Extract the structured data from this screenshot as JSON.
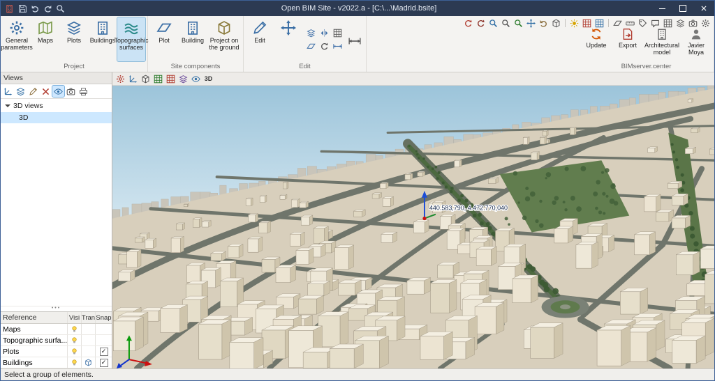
{
  "colors": {
    "titlebar": "#2c3a52",
    "ribbon_selection": "#cbe3f5",
    "tree_selection": "#cde8ff",
    "sky": "#a9cede",
    "accent": "#3a6ea5",
    "city_ground": "#d8cfbc"
  },
  "titlebar": {
    "title": "Open BIM Site - v2022.a - [C:\\...\\Madrid.bsite]"
  },
  "quick_access": [
    {
      "name": "save",
      "sym": "floppy"
    },
    {
      "name": "undo",
      "sym": "undo"
    },
    {
      "name": "redo",
      "sym": "redo"
    },
    {
      "name": "zoom",
      "sym": "magnifier"
    }
  ],
  "ribbon": {
    "groups": [
      {
        "label": "Project",
        "buttons": [
          {
            "label": "General parameters",
            "icon": "gear"
          },
          {
            "label": "Maps",
            "icon": "map"
          },
          {
            "label": "Plots",
            "icon": "layers"
          },
          {
            "label": "Buildings",
            "icon": "building"
          },
          {
            "label": "Topographic surfaces",
            "icon": "surface",
            "selected": true
          }
        ]
      },
      {
        "label": "Site components",
        "buttons": [
          {
            "label": "Plot",
            "icon": "plane"
          },
          {
            "label": "Building",
            "icon": "building"
          },
          {
            "label": "Project on the ground",
            "icon": "cube"
          }
        ]
      },
      {
        "label": "Edit",
        "buttons": [
          {
            "label": "Edit",
            "icon": "pencil"
          }
        ]
      },
      {
        "label": "BIMserver.center",
        "buttons": [
          {
            "label": "Update",
            "icon": "update"
          },
          {
            "label": "Export",
            "icon": "doc-export"
          },
          {
            "label": "Architectural model",
            "icon": "building"
          },
          {
            "label": "Javier Moya",
            "icon": "person"
          }
        ]
      }
    ],
    "edit_tools": [
      {
        "name": "copy",
        "sym": "layers",
        "color": "#3f6fa8"
      },
      {
        "name": "mirror",
        "sym": "mirror",
        "color": "#3f6fa8"
      },
      {
        "name": "align",
        "sym": "grid",
        "color": "#555555"
      },
      {
        "name": "offset",
        "sym": "plane",
        "color": "#3f6fa8"
      },
      {
        "name": "rotate",
        "sym": "orbit",
        "color": "#555555"
      },
      {
        "name": "scale",
        "sym": "measure-h",
        "color": "#3f6fa8"
      }
    ]
  },
  "nav_toolbar": {
    "icons": [
      {
        "name": "orbit",
        "sym": "orbit",
        "color": "#b03a2e"
      },
      {
        "name": "orbit-center",
        "sym": "orbit",
        "color": "#8a2d23"
      },
      {
        "name": "zoom-window",
        "sym": "magnifier",
        "color": "#2e6da4"
      },
      {
        "name": "zoom-in-out",
        "sym": "magnifier",
        "color": "#555555"
      },
      {
        "name": "zoom-extents",
        "sym": "magnifier",
        "color": "#2a7a2a"
      },
      {
        "name": "pan",
        "sym": "move",
        "color": "#2e6da4"
      },
      {
        "name": "previous-view",
        "sym": "undo",
        "color": "#8a6d3b"
      },
      {
        "name": "perspective",
        "sym": "cube",
        "color": "#555555"
      },
      {
        "sep": true
      },
      {
        "name": "shadows",
        "sym": "sun",
        "color": "#d6a400"
      },
      {
        "name": "textures",
        "sym": "grid",
        "color": "#b03a2e"
      },
      {
        "name": "edges",
        "sym": "grid",
        "color": "#2e6da4"
      },
      {
        "sep": true
      },
      {
        "name": "section-plane",
        "sym": "plane",
        "color": "#555555"
      },
      {
        "name": "measure",
        "sym": "ruler",
        "color": "#555555"
      },
      {
        "name": "dimensions",
        "sym": "tag",
        "color": "#555555"
      },
      {
        "name": "comments",
        "sym": "comment",
        "color": "#555555"
      },
      {
        "name": "reference-grid",
        "sym": "grid",
        "color": "#555555"
      },
      {
        "name": "layers",
        "sym": "layers",
        "color": "#555555"
      },
      {
        "name": "camera-views",
        "sym": "camera",
        "color": "#555555"
      },
      {
        "name": "configuration",
        "sym": "gear",
        "color": "#555555"
      }
    ]
  },
  "viewport_toolbar": {
    "icons": [
      {
        "name": "render-options",
        "sym": "gear",
        "color": "#b03a2e"
      },
      {
        "name": "work-plane",
        "sym": "axes",
        "color": "#2e6da4"
      },
      {
        "name": "view-orientation",
        "sym": "cube",
        "color": "#555555"
      },
      {
        "name": "analytical-grid",
        "sym": "grid",
        "color": "#2a7a2a"
      },
      {
        "name": "reference-grid",
        "sym": "grid",
        "color": "#b03a2e"
      },
      {
        "name": "materials",
        "sym": "layers",
        "color": "#6a4a9a"
      },
      {
        "name": "element-visibility",
        "sym": "eye",
        "color": "#2e6da4"
      },
      {
        "name": "view-3d",
        "text": "3D",
        "color": "#333333"
      }
    ]
  },
  "views_panel": {
    "title": "Views",
    "toolbar": [
      {
        "name": "new-view",
        "sym": "axes",
        "color": "#2e6da4"
      },
      {
        "name": "duplicate-view",
        "sym": "layers",
        "color": "#2e6da4"
      },
      {
        "name": "edit-view",
        "sym": "pencil",
        "color": "#8a6d3b"
      },
      {
        "name": "delete-view",
        "sym": "close",
        "color": "#b03a2e"
      },
      {
        "name": "view-settings",
        "sym": "eye",
        "color": "#2e6da4",
        "active": true
      },
      {
        "name": "camera",
        "sym": "camera",
        "color": "#555555"
      },
      {
        "name": "snapshot",
        "sym": "printer",
        "color": "#555555"
      }
    ],
    "tree": {
      "root": "3D views",
      "child": "3D"
    }
  },
  "layers_table": {
    "headers": [
      "Reference",
      "Visi",
      "Tran",
      "Snap"
    ],
    "rows": [
      {
        "reference": "Maps",
        "visible": true,
        "transparent": false,
        "snap": false
      },
      {
        "reference": "Topographic surfa...",
        "visible": true,
        "transparent": false,
        "snap": false
      },
      {
        "reference": "Plots",
        "visible": true,
        "transparent": false,
        "snap": true
      },
      {
        "reference": "Buildings",
        "visible": true,
        "transparent": true,
        "snap": true
      }
    ]
  },
  "viewport": {
    "coordinates": "440.583,790, 4.472.770,040"
  },
  "statusbar": {
    "text": "Select a group of elements."
  }
}
